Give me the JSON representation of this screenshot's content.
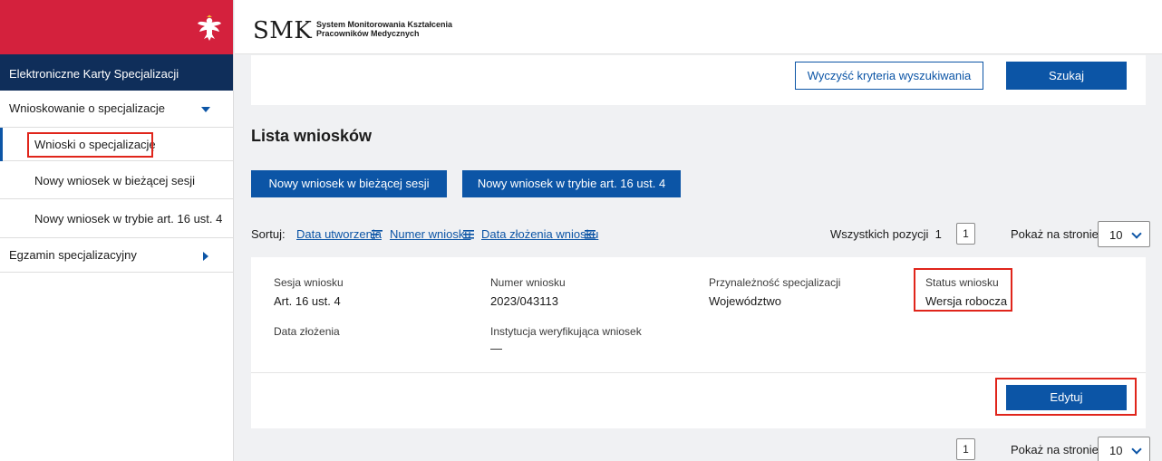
{
  "sidebar": {
    "section_title": "Elektroniczne Karty Specjalizacji",
    "items": [
      {
        "label": "Wnioskowanie o specjalizacje",
        "icon": "caret-down-icon"
      },
      {
        "label": "Wnioski o specjalizację"
      },
      {
        "label": "Nowy wniosek w bieżącej sesji"
      },
      {
        "label": "Nowy wniosek w trybie art. 16 ust. 4"
      },
      {
        "label": "Egzamin specjalizacyjny",
        "icon": "caret-right-icon"
      }
    ]
  },
  "header": {
    "logo_text": "SMK",
    "logo_desc_line1": "System Monitorowania Kształcenia",
    "logo_desc_line2": "Pracowników Medycznych",
    "brand_color": "#d4213d",
    "emblem_icon": "polish-eagle-icon"
  },
  "search": {
    "clear_label": "Wyczyść kryteria wyszukiwania",
    "search_label": "Szukaj"
  },
  "list": {
    "title": "Lista wniosków",
    "new_current_label": "Nowy wniosek w bieżącej sesji",
    "new_art_label": "Nowy wniosek w trybie art. 16 ust. 4",
    "sort_label": "Sortuj:",
    "sort_options": [
      "Data utworzenia",
      "Numer wniosku",
      "Data złożenia wniosku"
    ],
    "total_label": "Wszystkich pozycji",
    "total_count": "1",
    "page": "1",
    "per_page_label": "Pokaż na stronie",
    "per_page_value": "10"
  },
  "card": {
    "session_label": "Sesja wniosku",
    "session_value": "Art. 16 ust. 4",
    "number_label": "Numer wniosku",
    "number_value": "2023/043113",
    "affiliation_label": "Przynależność specjalizacji",
    "affiliation_value": "Województwo",
    "status_label": "Status wniosku",
    "status_value": "Wersja robocza",
    "submitted_label": "Data złożenia",
    "institution_label": "Instytucja weryfikująca wniosek",
    "institution_value": "—",
    "edit_label": "Edytuj"
  },
  "colors": {
    "primary": "#0c55a6",
    "navy": "#0f2e5a",
    "highlight": "#e0251b"
  }
}
